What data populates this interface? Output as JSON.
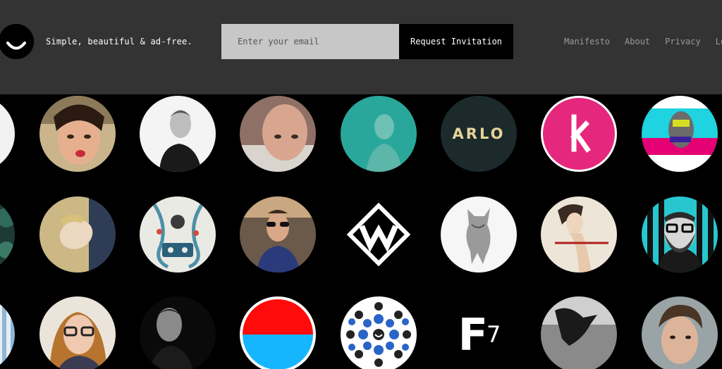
{
  "header": {
    "tagline": "Simple, beautiful & ad-free.",
    "email_placeholder": "Enter your email",
    "request_label": "Request Invitation",
    "nav": [
      "Manifesto",
      "About",
      "Privacy",
      "Lo"
    ]
  },
  "avatars": {
    "row1": [
      {
        "name": "avatar-partial-white",
        "icon": "blank-white-circle"
      },
      {
        "name": "avatar-woman-selfie",
        "icon": "woman-photo"
      },
      {
        "name": "avatar-man-bw-suit",
        "icon": "man-photo"
      },
      {
        "name": "avatar-bald-man",
        "icon": "man-photo"
      },
      {
        "name": "avatar-man-teal",
        "icon": "man-photo"
      },
      {
        "name": "avatar-arlo-logo",
        "label": "ARLO",
        "icon": "wordmark-logo"
      },
      {
        "name": "avatar-pink-k-logo",
        "icon": "letter-k-logo"
      },
      {
        "name": "avatar-glitch-art",
        "icon": "glitch-art"
      }
    ],
    "row2": [
      {
        "name": "avatar-partial-dark",
        "icon": "dark-photo"
      },
      {
        "name": "avatar-blonde-woman",
        "icon": "woman-photo"
      },
      {
        "name": "avatar-collage-art",
        "icon": "collage-art"
      },
      {
        "name": "avatar-man-sunglasses",
        "icon": "man-photo"
      },
      {
        "name": "avatar-w-logo",
        "icon": "letter-w-logo"
      },
      {
        "name": "avatar-creature-sketch",
        "icon": "sketch-art"
      },
      {
        "name": "avatar-illustration-woman",
        "icon": "illustration"
      },
      {
        "name": "avatar-bearded-man-glasses",
        "icon": "man-photo"
      }
    ],
    "row3": [
      {
        "name": "avatar-partial-blue",
        "icon": "blue-photo"
      },
      {
        "name": "avatar-woman-glasses",
        "icon": "woman-photo"
      },
      {
        "name": "avatar-man-bw",
        "icon": "man-photo"
      },
      {
        "name": "avatar-red-blue-circle",
        "icon": "red-blue-split"
      },
      {
        "name": "avatar-dots-smile",
        "icon": "dot-pattern"
      },
      {
        "name": "avatar-f7-logo",
        "label_main": "F",
        "label_sub": "7",
        "icon": "f7-logo"
      },
      {
        "name": "avatar-shadow-photo",
        "icon": "shadow-photo"
      },
      {
        "name": "avatar-young-man",
        "icon": "man-photo"
      }
    ]
  },
  "colors": {
    "header_bg": "#333333",
    "input_bg": "#c7c7c7",
    "button_bg": "#000000",
    "nav_text": "#9a9a9a",
    "accent_pink": "#e5287d",
    "accent_teal": "#2aa79b"
  }
}
